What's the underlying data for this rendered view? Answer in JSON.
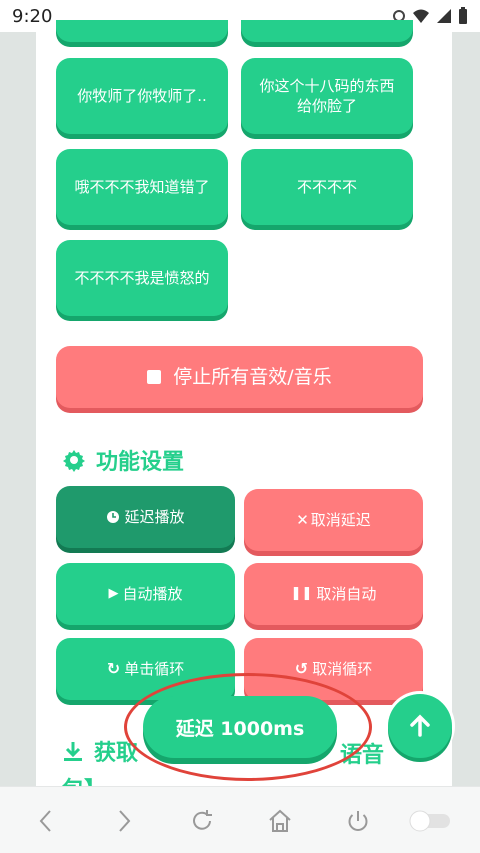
{
  "status": {
    "time": "9:20"
  },
  "sound_buttons": [
    {
      "label": "你牧师了你牧师了.."
    },
    {
      "label": "你这个十八码的东西给你脸了"
    },
    {
      "label": "哦不不不我知道错了"
    },
    {
      "label": "不不不不"
    },
    {
      "label": "不不不不我是愤怒的"
    }
  ],
  "stop_all": {
    "label": "停止所有音效/音乐"
  },
  "settings": {
    "title": "功能设置",
    "delay_play": "延迟播放",
    "cancel_delay": "取消延迟",
    "auto_play": "自动播放",
    "cancel_auto": "取消自动",
    "loop_single": "单击循环",
    "cancel_loop": "取消循环"
  },
  "overlay": {
    "delay_label": "延迟 1000ms"
  },
  "download_section": {
    "title_start": "获取",
    "title_end": "语音",
    "title_next": "包】"
  },
  "colors": {
    "accent": "#25cf8c",
    "danger": "#ff7b7d",
    "dark_green": "#1f9a6c"
  }
}
